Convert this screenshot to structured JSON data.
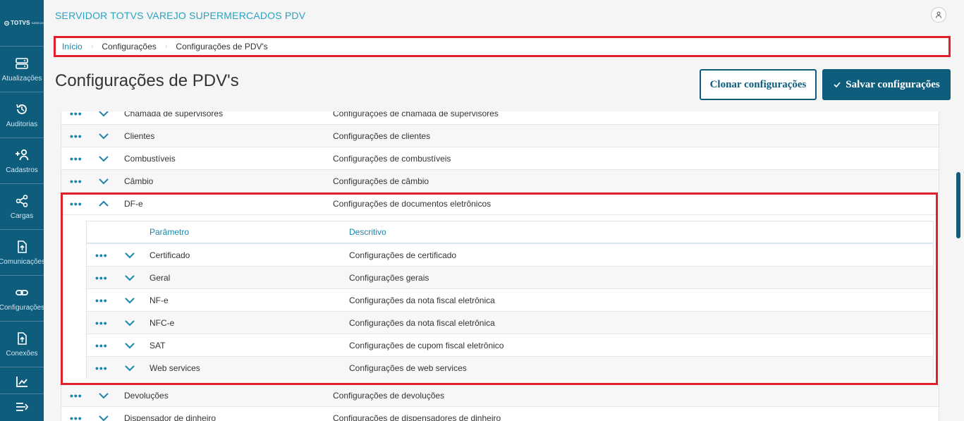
{
  "sidebar": {
    "logo": "TOTVS",
    "logo_sub": "VAREJO",
    "items": [
      {
        "label": "Atualizações",
        "icon": "server-icon"
      },
      {
        "label": "Auditorias",
        "icon": "history-icon"
      },
      {
        "label": "Cadastros",
        "icon": "add-user-icon"
      },
      {
        "label": "Cargas",
        "icon": "share-icon"
      },
      {
        "label": "Comunicações",
        "icon": "upload-file-icon"
      },
      {
        "label": "Configurações",
        "icon": "link-icon"
      },
      {
        "label": "Conexões",
        "icon": "upload-file-icon"
      },
      {
        "label": "",
        "icon": "chart-icon"
      }
    ],
    "collapse_icon": "menu-collapse-icon"
  },
  "header": {
    "app_title": "SERVIDOR TOTVS VAREJO SUPERMERCADOS PDV",
    "avatar_icon": "user-icon"
  },
  "breadcrumb": [
    "Início",
    "Configurações",
    "Configurações de PDV's"
  ],
  "page": {
    "title": "Configurações de PDV's",
    "clone_label": "Clonar configurações",
    "save_label": "Salvar configurações"
  },
  "table": {
    "rows_before": [
      {
        "name": "Chamada de supervisores",
        "desc": "Configurações de chamada de supervisores"
      },
      {
        "name": "Clientes",
        "desc": "Configurações de clientes"
      },
      {
        "name": "Combustíveis",
        "desc": "Configurações de combustíveis"
      },
      {
        "name": "Câmbio",
        "desc": "Configurações de câmbio"
      }
    ],
    "expanded_row": {
      "name": "DF-e",
      "desc": "Configurações de documentos eletrônicos"
    },
    "sub_headers": {
      "param": "Parâmetro",
      "desc": "Descritivo"
    },
    "sub_rows": [
      {
        "name": "Certificado",
        "desc": "Configurações de certificado"
      },
      {
        "name": "Geral",
        "desc": "Configurações gerais"
      },
      {
        "name": "NF-e",
        "desc": "Configurações da nota fiscal eletrônica"
      },
      {
        "name": "NFC-e",
        "desc": "Configurações da nota fiscal eletrônica"
      },
      {
        "name": "SAT",
        "desc": "Configurações de cupom fiscal eletrônico"
      },
      {
        "name": "Web services",
        "desc": "Configurações de web services"
      }
    ],
    "rows_after": [
      {
        "name": "Devoluções",
        "desc": "Configurações de devoluções"
      },
      {
        "name": "Dispensador de dinheiro",
        "desc": "Configurações de dispensadores de dinheiro"
      }
    ],
    "dots": "•••"
  },
  "colors": {
    "accent": "#0f5d7d",
    "link": "#1b84a9",
    "highlight": "#e0202a"
  }
}
